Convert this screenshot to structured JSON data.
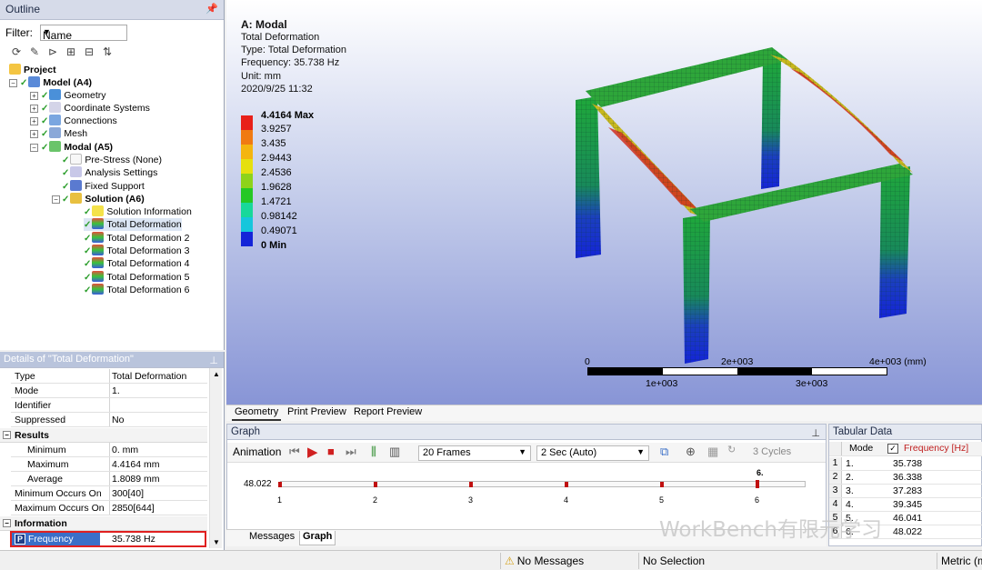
{
  "outline": {
    "title": "Outline",
    "filter_label": "Filter:",
    "filter_value": "Name",
    "tree": [
      {
        "label": "Project",
        "bold": true
      },
      {
        "label": "Model (A4)",
        "bold": true
      },
      {
        "label": "Geometry"
      },
      {
        "label": "Coordinate Systems"
      },
      {
        "label": "Connections"
      },
      {
        "label": "Mesh"
      },
      {
        "label": "Modal (A5)",
        "bold": true
      },
      {
        "label": "Pre-Stress (None)"
      },
      {
        "label": "Analysis Settings"
      },
      {
        "label": "Fixed Support"
      },
      {
        "label": "Solution (A6)",
        "bold": true
      },
      {
        "label": "Solution Information"
      },
      {
        "label": "Total Deformation"
      },
      {
        "label": "Total Deformation 2"
      },
      {
        "label": "Total Deformation 3"
      },
      {
        "label": "Total Deformation 4"
      },
      {
        "label": "Total Deformation 5"
      },
      {
        "label": "Total Deformation 6"
      }
    ]
  },
  "details": {
    "title": "Details of \"Total Deformation\"",
    "rows": [
      {
        "k": "Type",
        "v": "Total Deformation"
      },
      {
        "k": "Mode",
        "v": "1."
      },
      {
        "k": "Identifier",
        "v": ""
      },
      {
        "k": "Suppressed",
        "v": "No"
      }
    ],
    "results_group": "Results",
    "results": [
      {
        "k": "Minimum",
        "v": "0. mm"
      },
      {
        "k": "Maximum",
        "v": "4.4164 mm"
      },
      {
        "k": "Average",
        "v": "1.8089 mm"
      },
      {
        "k": "Minimum Occurs On",
        "v": "300[40]"
      },
      {
        "k": "Maximum Occurs On",
        "v": "2850[644]"
      }
    ],
    "info_group": "Information",
    "frequency": {
      "k": "Frequency",
      "v": "35.738 Hz",
      "badge": "P"
    }
  },
  "viewport": {
    "header": [
      "A: Modal",
      "Total Deformation",
      "Type: Total Deformation",
      "Frequency: 35.738 Hz",
      "Unit: mm",
      "2020/9/25 11:32"
    ],
    "legend": [
      {
        "label": "4.4164 Max",
        "color": "#e8201a"
      },
      {
        "label": "3.9257",
        "color": "#f07a12"
      },
      {
        "label": "3.435",
        "color": "#f4b50f"
      },
      {
        "label": "2.9443",
        "color": "#e6e00e"
      },
      {
        "label": "2.4536",
        "color": "#8ed31a"
      },
      {
        "label": "1.9628",
        "color": "#25c825"
      },
      {
        "label": "1.4721",
        "color": "#18d89a"
      },
      {
        "label": "0.98142",
        "color": "#16c6dc"
      },
      {
        "label": "0.49071",
        "color": "#1278e8"
      },
      {
        "label": "0 Min",
        "color": "#1424d8"
      }
    ],
    "scale_top": [
      "0",
      "2e+003",
      "4e+003 (mm)"
    ],
    "scale_bottom": [
      "1e+003",
      "3e+003"
    ]
  },
  "view_tabs": [
    "Geometry",
    "Print Preview",
    "Report Preview"
  ],
  "graph": {
    "title": "Graph",
    "animation_label": "Animation",
    "frames": "20 Frames",
    "duration": "2 Sec (Auto)",
    "cycles": "3 Cycles",
    "y_label": "48.022",
    "x_ticks": [
      "1",
      "2",
      "3",
      "4",
      "5",
      "6"
    ],
    "top_label": "6."
  },
  "bottom_tabs": [
    "Messages",
    "Graph"
  ],
  "tabular": {
    "title": "Tabular Data",
    "col_mode": "Mode",
    "col_freq": "Frequency [Hz]",
    "rows": [
      {
        "n": "1",
        "mode": "1.",
        "freq": "35.738"
      },
      {
        "n": "2",
        "mode": "2.",
        "freq": "36.338"
      },
      {
        "n": "3",
        "mode": "3.",
        "freq": "37.283"
      },
      {
        "n": "4",
        "mode": "4.",
        "freq": "39.345"
      },
      {
        "n": "5",
        "mode": "5.",
        "freq": "46.041"
      },
      {
        "n": "6",
        "mode": "6.",
        "freq": "48.022"
      }
    ]
  },
  "status": {
    "messages": "No Messages",
    "selection": "No Selection",
    "units": "Metric (m"
  },
  "watermark": "WorkBench有限元学习"
}
